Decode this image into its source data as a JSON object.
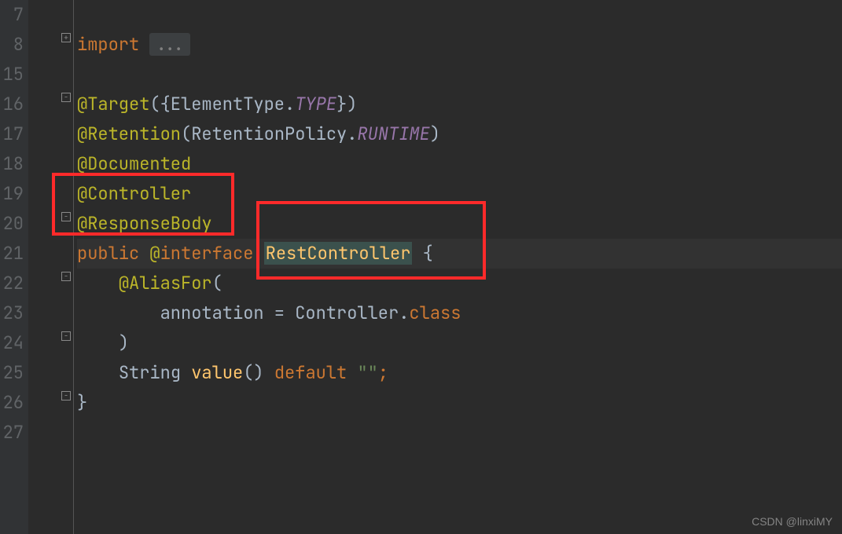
{
  "gutter": [
    "7",
    "8",
    "15",
    "16",
    "17",
    "18",
    "19",
    "20",
    "21",
    "22",
    "23",
    "24",
    "25",
    "26",
    "27"
  ],
  "code": {
    "import_kw": "import ",
    "import_fold": "...",
    "l16_anno": "@Target",
    "l16_rest1": "({ElementType.",
    "l16_type": "TYPE",
    "l16_rest2": "})",
    "l17_anno": "@Retention",
    "l17_rest1": "(RetentionPolicy.",
    "l17_type": "RUNTIME",
    "l17_rest2": ")",
    "l18_anno": "@Documented",
    "l19_anno": "@Controller",
    "l20_anno": "@ResponseBody",
    "l21_public": "public ",
    "l21_at": "@",
    "l21_interface": "interface",
    "l21_space": " ",
    "l21_name": "RestController",
    "l21_brace": " {",
    "l22_anno": "@AliasFor",
    "l22_paren": "(",
    "l23_param": "annotation = Controller",
    "l23_dot": ".",
    "l23_class": "class",
    "l24_paren": ")",
    "l25_string_t": "String ",
    "l25_value": "value",
    "l25_paren": "() ",
    "l25_default": "default ",
    "l25_str": "\"\"",
    "l25_semi": ";",
    "l26_brace": "}"
  },
  "watermark": "CSDN @linxiMY"
}
